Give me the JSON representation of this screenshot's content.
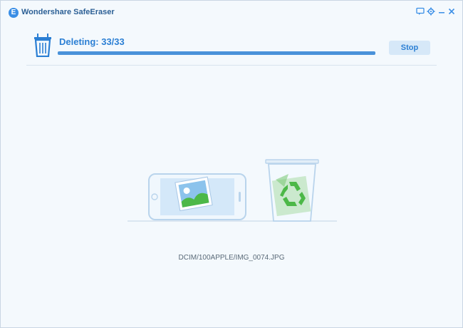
{
  "app": {
    "title": "Wondershare SafeEraser",
    "logo_letter": "E"
  },
  "window_controls": {
    "feedback_icon": "speech-bubble-icon",
    "settings_icon": "gear-icon",
    "minimize_icon": "minimize-icon",
    "close_icon": "close-icon"
  },
  "progress": {
    "status_label": "Deleting: 33/33",
    "completed": 33,
    "total": 33,
    "fraction": 1.0,
    "stop_label": "Stop"
  },
  "current_file": "DCIM/100APPLE/IMG_0074.JPG",
  "colors": {
    "accent": "#2b7fd4",
    "progress_fill": "#4a92da",
    "recycle_green": "#4cb848"
  }
}
